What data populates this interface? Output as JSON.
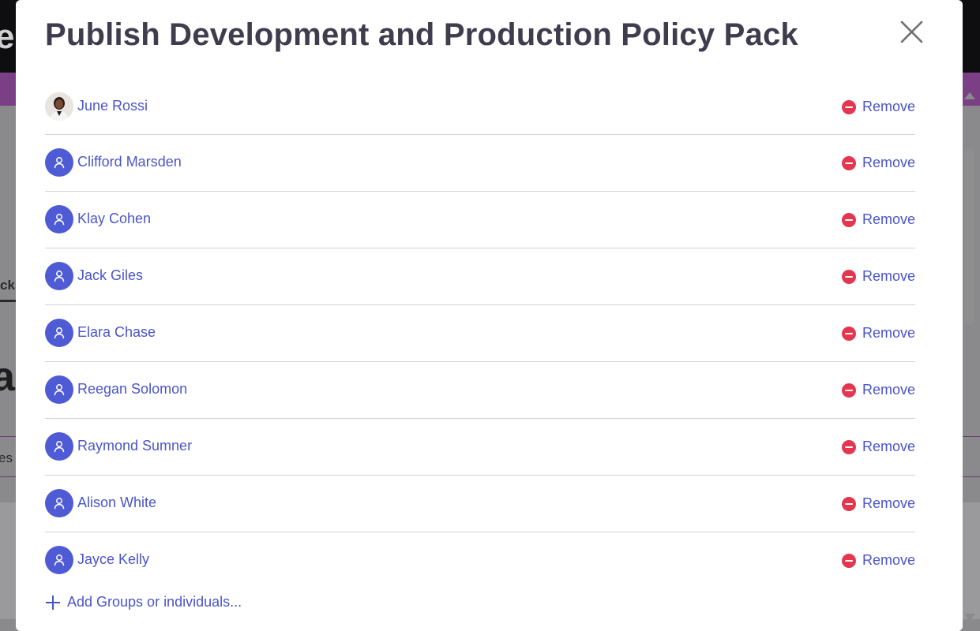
{
  "dialog": {
    "title": "Publish Development and Production Policy Pack",
    "close_icon": "close-icon"
  },
  "members": [
    {
      "name": "June Rossi",
      "avatar": "photo",
      "remove_label": "Remove"
    },
    {
      "name": "Clifford Marsden",
      "avatar": "user-icon",
      "remove_label": "Remove"
    },
    {
      "name": "Klay Cohen",
      "avatar": "user-icon",
      "remove_label": "Remove"
    },
    {
      "name": "Jack Giles",
      "avatar": "user-icon",
      "remove_label": "Remove"
    },
    {
      "name": "Elara Chase",
      "avatar": "user-icon",
      "remove_label": "Remove"
    },
    {
      "name": "Reegan Solomon",
      "avatar": "user-icon",
      "remove_label": "Remove"
    },
    {
      "name": "Raymond Sumner",
      "avatar": "user-icon",
      "remove_label": "Remove"
    },
    {
      "name": "Alison White",
      "avatar": "user-icon",
      "remove_label": "Remove"
    },
    {
      "name": "Jayce Kelly",
      "avatar": "user-icon",
      "remove_label": "Remove"
    }
  ],
  "add_link": {
    "label": "Add Groups or individuals..."
  },
  "background": {
    "tab_fragment": "cks",
    "heading_fragment": "ac",
    "text_fragment": "es",
    "letter_fragment": "e"
  },
  "colors": {
    "accent": "#4a55c8",
    "avatar_bg": "#4f5bd5",
    "remove_red": "#e5364f",
    "title": "#3f3d4d"
  }
}
